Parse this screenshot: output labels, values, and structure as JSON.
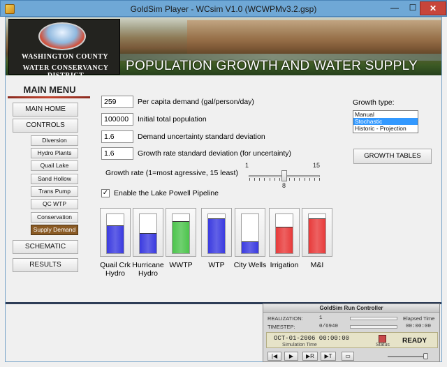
{
  "window": {
    "title": "GoldSim Player - WCsim V1.0 (WCWPMv3.2.gsp)",
    "min_glyph": "—",
    "max_glyph": "☐",
    "close_glyph": "✕"
  },
  "banner": {
    "logo_line1": "WASHINGTON COUNTY",
    "logo_line2": "WATER CONSERVANCY DISTRICT",
    "title": "POPULATION GROWTH AND WATER SUPPLY"
  },
  "main_menu": {
    "title": "MAIN MENU",
    "home": "MAIN HOME",
    "controls": "CONTROLS",
    "sub_items": [
      "Diversion",
      "Hydro Plants",
      "Quail Lake",
      "Sand Hollow",
      "Trans Pump",
      "QC WTP",
      "Conservation",
      "Supply Demand"
    ],
    "schematic": "SCHEMATIC",
    "results": "RESULTS"
  },
  "inputs": [
    {
      "value": "259",
      "label": "Per capita demand (gal/person/day)"
    },
    {
      "value": "100000",
      "label": "Initial total population"
    },
    {
      "value": "1.6",
      "label": "Demand uncertainty standard deviation"
    },
    {
      "value": "1.6",
      "label": "Growth rate standard deviation (for uncertainty)"
    }
  ],
  "slider": {
    "label": "Growth rate (1=most agressive, 15 least)",
    "min": "1",
    "max": "15",
    "value": "8"
  },
  "checkbox": {
    "checked_glyph": "✓",
    "label": "Enable the Lake Powell Pipeline"
  },
  "tanks": [
    {
      "line1": "Quail Crk",
      "line2": "Hydro",
      "level": 0.72,
      "color": "#3a3ae0"
    },
    {
      "line1": "Hurricane",
      "line2": "Hydro",
      "level": 0.52,
      "color": "#3a3ae0"
    },
    {
      "line1": "WWTP",
      "line2": "",
      "level": 0.82,
      "color": "#4cc44c"
    },
    {
      "line1": "WTP",
      "line2": "",
      "level": 0.9,
      "color": "#3a3ae0"
    },
    {
      "line1": "City Wells",
      "line2": "",
      "level": 0.3,
      "color": "#3a3ae0"
    },
    {
      "line1": "Irrigation",
      "line2": "",
      "level": 0.68,
      "color": "#e83a3a"
    },
    {
      "line1": "M&I",
      "line2": "",
      "level": 0.9,
      "color": "#e83a3a"
    }
  ],
  "growth_type": {
    "label": "Growth type:",
    "options": [
      "Manual",
      "Stochastic",
      "Historic - Projection"
    ],
    "selected": "Stochastic",
    "tables_button": "GROWTH TABLES"
  },
  "run_controller": {
    "title": "GoldSim Run Controller",
    "realization_label": "REALIZATION:",
    "realization_value": "1",
    "timestep_label": "TIMESTEP:",
    "timestep_value": "0/6940",
    "elapsed_label": "Elapsed Time",
    "elapsed_1": "00:00:00",
    "elapsed_2": "00:00:00",
    "date": "OCT-01-2006 00:00:00",
    "sim_time_label": "Simulation Time",
    "status_label": "Status",
    "ready": "READY",
    "buttons": [
      "|◀",
      "▶",
      "▶R",
      "▶T",
      "▭"
    ]
  }
}
